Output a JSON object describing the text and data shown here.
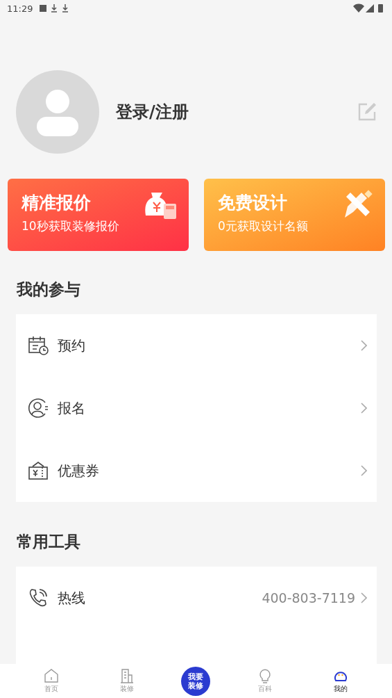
{
  "status_bar": {
    "time": "11:29"
  },
  "profile": {
    "login_label": "登录/注册"
  },
  "promo_cards": [
    {
      "kind": "quote",
      "title": "精准报价",
      "subtitle": "10秒获取装修报价"
    },
    {
      "kind": "design",
      "title": "免费设计",
      "subtitle": "0元获取设计名额"
    }
  ],
  "participation": {
    "title": "我的参与",
    "items": [
      {
        "kind": "calendar",
        "label": "预约"
      },
      {
        "kind": "person",
        "label": "报名"
      },
      {
        "kind": "coupon",
        "label": "优惠券"
      }
    ]
  },
  "tools": {
    "title": "常用工具",
    "items": [
      {
        "kind": "phone",
        "label": "热线",
        "value": "400-803-7119"
      }
    ]
  },
  "bottom_nav": [
    {
      "kind": "home",
      "label": "首页",
      "selected": false
    },
    {
      "kind": "building",
      "label": "装修",
      "selected": false
    },
    {
      "kind": "center",
      "label": "我要装修",
      "selected": false
    },
    {
      "kind": "bulb",
      "label": "百科",
      "selected": false
    },
    {
      "kind": "mine",
      "label": "我的",
      "selected": true
    }
  ]
}
